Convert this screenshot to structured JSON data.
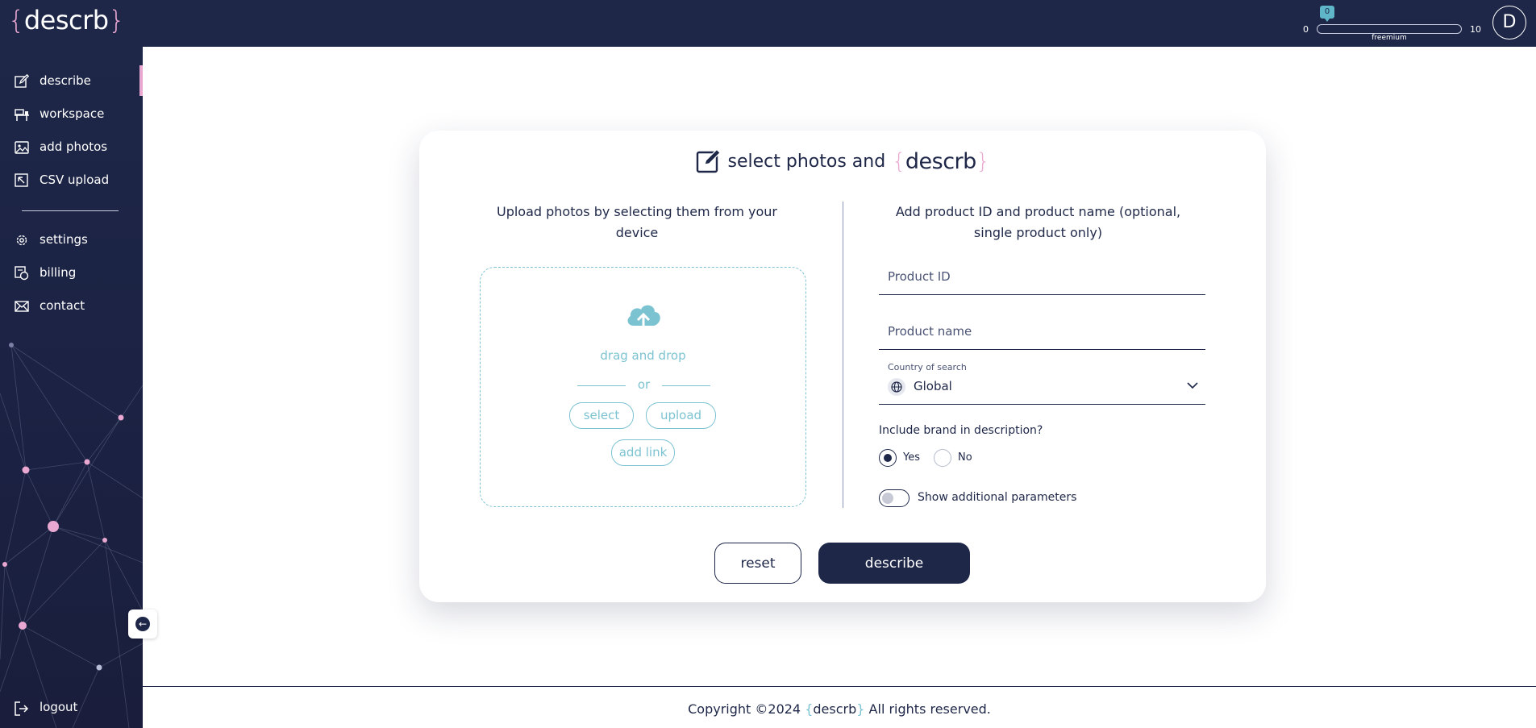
{
  "brand": {
    "open": "{",
    "name": "descrb",
    "close": "}"
  },
  "usage": {
    "count": "0",
    "min": "0",
    "max": "10",
    "plan": "freemium",
    "used_fraction": 0.0
  },
  "user": {
    "initial": "D"
  },
  "sidebar": {
    "items": [
      {
        "label": "describe",
        "icon": "edit-icon",
        "active": true
      },
      {
        "label": "workspace",
        "icon": "workspace-icon"
      },
      {
        "label": "add photos",
        "icon": "image-icon"
      },
      {
        "label": "CSV upload",
        "icon": "csv-upload-icon"
      },
      {
        "label": "settings",
        "icon": "gear-icon"
      },
      {
        "label": "billing",
        "icon": "billing-icon"
      },
      {
        "label": "contact",
        "icon": "mail-icon"
      }
    ],
    "logout": "logout"
  },
  "card": {
    "title": "select photos and",
    "left_text": "Upload photos by selecting them from your device",
    "drag_drop": "drag and drop",
    "or": "or",
    "select_button": "select",
    "upload_button": "upload",
    "add_link_button": "add link",
    "right_text": "Add product ID and product name (optional, single product only)",
    "product_id_placeholder": "Product ID",
    "product_name_placeholder": "Product name",
    "country_label": "Country of search",
    "country_value": "Global",
    "brand_question": "Include brand in description?",
    "radio_yes": "Yes",
    "radio_no": "No",
    "toggle_label": "Show additional parameters",
    "reset_button": "reset",
    "describe_button": "describe"
  },
  "footer": {
    "prefix": "Copyright ©2024",
    "suffix": "All rights reserved."
  },
  "colors": {
    "navy": "#1e2748",
    "pink": "#e9a8d1",
    "teal": "#7cc3d2"
  }
}
